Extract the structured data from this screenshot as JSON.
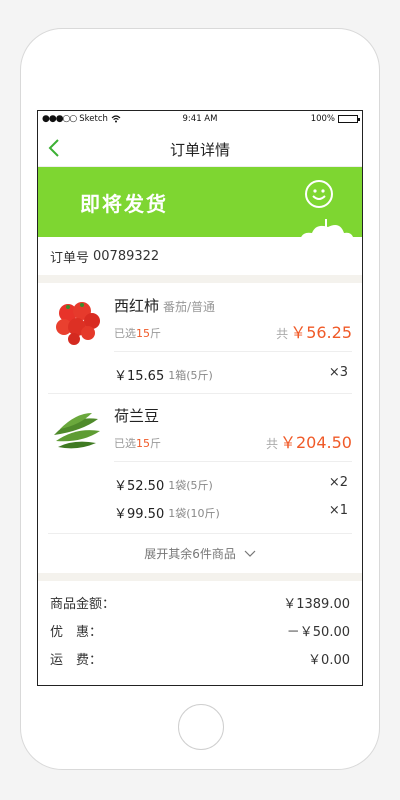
{
  "status_bar": {
    "carrier": "Sketch",
    "time": "9:41 AM",
    "battery": "100%"
  },
  "nav": {
    "title": "订单详情"
  },
  "banner": {
    "status": "即将发货"
  },
  "order": {
    "label": "订单号",
    "number": "00789322"
  },
  "products": [
    {
      "name": "西红柿",
      "spec": "番茄/普通",
      "selected_prefix": "已选",
      "selected_amount": "15",
      "selected_suffix": "斤",
      "total_prefix": "共",
      "total": "￥56.25",
      "lines": [
        {
          "price": "￥15.65",
          "unit": "1箱(5斤)",
          "qty": "×3"
        }
      ]
    },
    {
      "name": "荷兰豆",
      "spec": "",
      "selected_prefix": "已选",
      "selected_amount": "15",
      "selected_suffix": "斤",
      "total_prefix": "共",
      "total": "￥204.50",
      "lines": [
        {
          "price": "￥52.50",
          "unit": "1袋(5斤)",
          "qty": "×2"
        },
        {
          "price": "￥99.50",
          "unit": "1袋(10斤)",
          "qty": "×1"
        }
      ]
    }
  ],
  "expand_text": "展开其余6件商品",
  "summary": [
    {
      "label": "商品金额：",
      "value": "￥1389.00"
    },
    {
      "label": "优　惠：",
      "value": "－￥50.00"
    },
    {
      "label": "运　费：",
      "value": "￥0.00"
    }
  ],
  "colors": {
    "accent_green": "#7ed631",
    "price_orange": "#f05a28",
    "back_arrow": "#3cb034"
  }
}
